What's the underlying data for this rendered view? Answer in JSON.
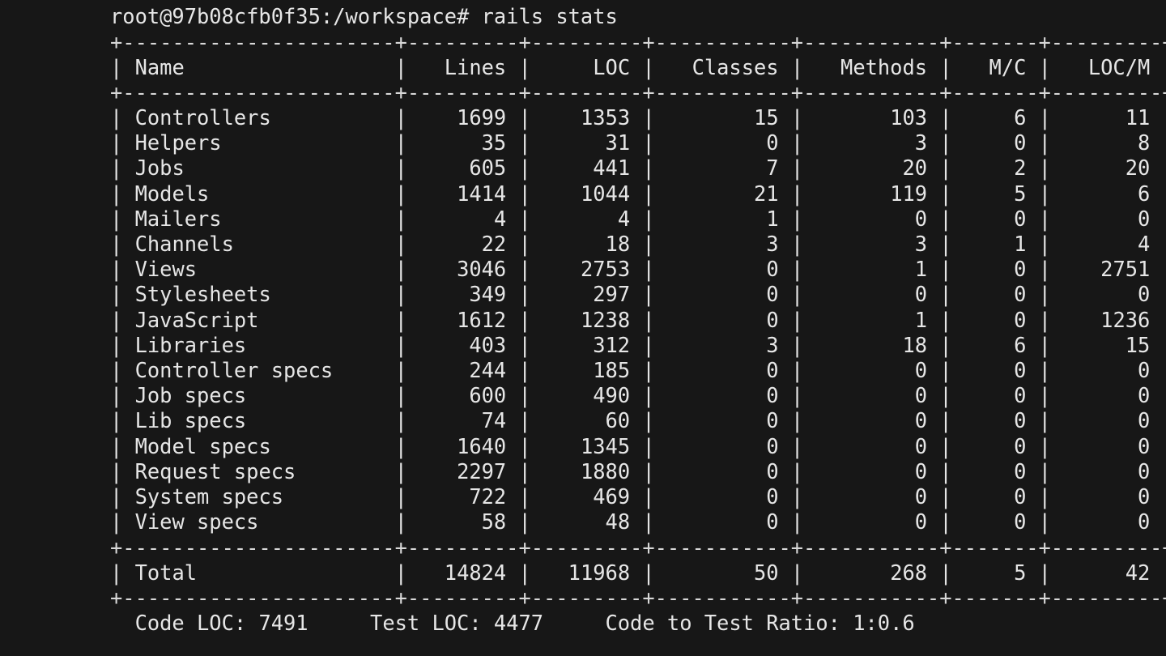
{
  "terminal": {
    "prompt": "root@97b08cfb0f35:/workspace#",
    "command": "rails stats"
  },
  "stats": {
    "headers": [
      "Name",
      "Lines",
      "LOC",
      "Classes",
      "Methods",
      "M/C",
      "LOC/M"
    ],
    "rows": [
      [
        "Controllers",
        "1699",
        "1353",
        "15",
        "103",
        "6",
        "11"
      ],
      [
        "Helpers",
        "35",
        "31",
        "0",
        "3",
        "0",
        "8"
      ],
      [
        "Jobs",
        "605",
        "441",
        "7",
        "20",
        "2",
        "20"
      ],
      [
        "Models",
        "1414",
        "1044",
        "21",
        "119",
        "5",
        "6"
      ],
      [
        "Mailers",
        "4",
        "4",
        "1",
        "0",
        "0",
        "0"
      ],
      [
        "Channels",
        "22",
        "18",
        "3",
        "3",
        "1",
        "4"
      ],
      [
        "Views",
        "3046",
        "2753",
        "0",
        "1",
        "0",
        "2751"
      ],
      [
        "Stylesheets",
        "349",
        "297",
        "0",
        "0",
        "0",
        "0"
      ],
      [
        "JavaScript",
        "1612",
        "1238",
        "0",
        "1",
        "0",
        "1236"
      ],
      [
        "Libraries",
        "403",
        "312",
        "3",
        "18",
        "6",
        "15"
      ],
      [
        "Controller specs",
        "244",
        "185",
        "0",
        "0",
        "0",
        "0"
      ],
      [
        "Job specs",
        "600",
        "490",
        "0",
        "0",
        "0",
        "0"
      ],
      [
        "Lib specs",
        "74",
        "60",
        "0",
        "0",
        "0",
        "0"
      ],
      [
        "Model specs",
        "1640",
        "1345",
        "0",
        "0",
        "0",
        "0"
      ],
      [
        "Request specs",
        "2297",
        "1880",
        "0",
        "0",
        "0",
        "0"
      ],
      [
        "System specs",
        "722",
        "469",
        "0",
        "0",
        "0",
        "0"
      ],
      [
        "View specs",
        "58",
        "48",
        "0",
        "0",
        "0",
        "0"
      ]
    ],
    "total": [
      "Total",
      "14824",
      "11968",
      "50",
      "268",
      "5",
      "42"
    ]
  },
  "summary": {
    "code_loc": "Code LOC: 7491",
    "test_loc": "Test LOC: 4477",
    "ratio": "Code to Test Ratio: 1:0.6"
  }
}
